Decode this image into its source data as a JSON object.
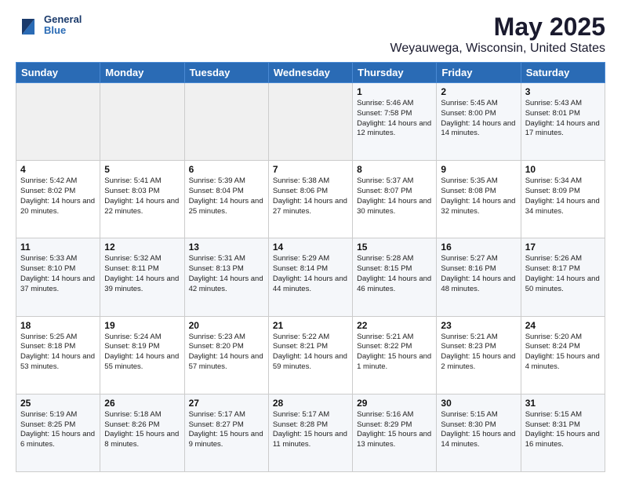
{
  "header": {
    "logo_line1": "General",
    "logo_line2": "Blue",
    "title": "May 2025",
    "subtitle": "Weyauwega, Wisconsin, United States"
  },
  "days_of_week": [
    "Sunday",
    "Monday",
    "Tuesday",
    "Wednesday",
    "Thursday",
    "Friday",
    "Saturday"
  ],
  "weeks": [
    [
      {
        "day": "",
        "detail": ""
      },
      {
        "day": "",
        "detail": ""
      },
      {
        "day": "",
        "detail": ""
      },
      {
        "day": "",
        "detail": ""
      },
      {
        "day": "1",
        "detail": "Sunrise: 5:46 AM\nSunset: 7:58 PM\nDaylight: 14 hours\nand 12 minutes."
      },
      {
        "day": "2",
        "detail": "Sunrise: 5:45 AM\nSunset: 8:00 PM\nDaylight: 14 hours\nand 14 minutes."
      },
      {
        "day": "3",
        "detail": "Sunrise: 5:43 AM\nSunset: 8:01 PM\nDaylight: 14 hours\nand 17 minutes."
      }
    ],
    [
      {
        "day": "4",
        "detail": "Sunrise: 5:42 AM\nSunset: 8:02 PM\nDaylight: 14 hours\nand 20 minutes."
      },
      {
        "day": "5",
        "detail": "Sunrise: 5:41 AM\nSunset: 8:03 PM\nDaylight: 14 hours\nand 22 minutes."
      },
      {
        "day": "6",
        "detail": "Sunrise: 5:39 AM\nSunset: 8:04 PM\nDaylight: 14 hours\nand 25 minutes."
      },
      {
        "day": "7",
        "detail": "Sunrise: 5:38 AM\nSunset: 8:06 PM\nDaylight: 14 hours\nand 27 minutes."
      },
      {
        "day": "8",
        "detail": "Sunrise: 5:37 AM\nSunset: 8:07 PM\nDaylight: 14 hours\nand 30 minutes."
      },
      {
        "day": "9",
        "detail": "Sunrise: 5:35 AM\nSunset: 8:08 PM\nDaylight: 14 hours\nand 32 minutes."
      },
      {
        "day": "10",
        "detail": "Sunrise: 5:34 AM\nSunset: 8:09 PM\nDaylight: 14 hours\nand 34 minutes."
      }
    ],
    [
      {
        "day": "11",
        "detail": "Sunrise: 5:33 AM\nSunset: 8:10 PM\nDaylight: 14 hours\nand 37 minutes."
      },
      {
        "day": "12",
        "detail": "Sunrise: 5:32 AM\nSunset: 8:11 PM\nDaylight: 14 hours\nand 39 minutes."
      },
      {
        "day": "13",
        "detail": "Sunrise: 5:31 AM\nSunset: 8:13 PM\nDaylight: 14 hours\nand 42 minutes."
      },
      {
        "day": "14",
        "detail": "Sunrise: 5:29 AM\nSunset: 8:14 PM\nDaylight: 14 hours\nand 44 minutes."
      },
      {
        "day": "15",
        "detail": "Sunrise: 5:28 AM\nSunset: 8:15 PM\nDaylight: 14 hours\nand 46 minutes."
      },
      {
        "day": "16",
        "detail": "Sunrise: 5:27 AM\nSunset: 8:16 PM\nDaylight: 14 hours\nand 48 minutes."
      },
      {
        "day": "17",
        "detail": "Sunrise: 5:26 AM\nSunset: 8:17 PM\nDaylight: 14 hours\nand 50 minutes."
      }
    ],
    [
      {
        "day": "18",
        "detail": "Sunrise: 5:25 AM\nSunset: 8:18 PM\nDaylight: 14 hours\nand 53 minutes."
      },
      {
        "day": "19",
        "detail": "Sunrise: 5:24 AM\nSunset: 8:19 PM\nDaylight: 14 hours\nand 55 minutes."
      },
      {
        "day": "20",
        "detail": "Sunrise: 5:23 AM\nSunset: 8:20 PM\nDaylight: 14 hours\nand 57 minutes."
      },
      {
        "day": "21",
        "detail": "Sunrise: 5:22 AM\nSunset: 8:21 PM\nDaylight: 14 hours\nand 59 minutes."
      },
      {
        "day": "22",
        "detail": "Sunrise: 5:21 AM\nSunset: 8:22 PM\nDaylight: 15 hours\nand 1 minute."
      },
      {
        "day": "23",
        "detail": "Sunrise: 5:21 AM\nSunset: 8:23 PM\nDaylight: 15 hours\nand 2 minutes."
      },
      {
        "day": "24",
        "detail": "Sunrise: 5:20 AM\nSunset: 8:24 PM\nDaylight: 15 hours\nand 4 minutes."
      }
    ],
    [
      {
        "day": "25",
        "detail": "Sunrise: 5:19 AM\nSunset: 8:25 PM\nDaylight: 15 hours\nand 6 minutes."
      },
      {
        "day": "26",
        "detail": "Sunrise: 5:18 AM\nSunset: 8:26 PM\nDaylight: 15 hours\nand 8 minutes."
      },
      {
        "day": "27",
        "detail": "Sunrise: 5:17 AM\nSunset: 8:27 PM\nDaylight: 15 hours\nand 9 minutes."
      },
      {
        "day": "28",
        "detail": "Sunrise: 5:17 AM\nSunset: 8:28 PM\nDaylight: 15 hours\nand 11 minutes."
      },
      {
        "day": "29",
        "detail": "Sunrise: 5:16 AM\nSunset: 8:29 PM\nDaylight: 15 hours\nand 13 minutes."
      },
      {
        "day": "30",
        "detail": "Sunrise: 5:15 AM\nSunset: 8:30 PM\nDaylight: 15 hours\nand 14 minutes."
      },
      {
        "day": "31",
        "detail": "Sunrise: 5:15 AM\nSunset: 8:31 PM\nDaylight: 15 hours\nand 16 minutes."
      }
    ]
  ]
}
